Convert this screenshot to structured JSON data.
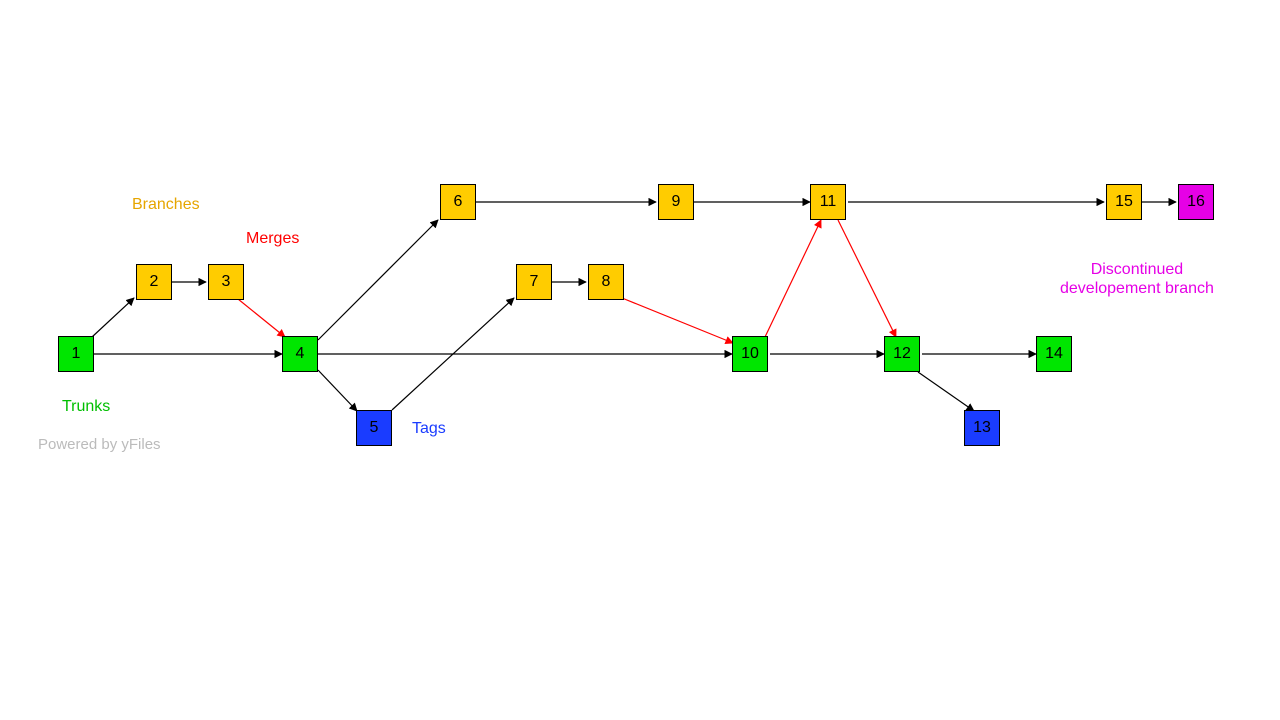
{
  "nodes": {
    "n1": "1",
    "n2": "2",
    "n3": "3",
    "n4": "4",
    "n5": "5",
    "n6": "6",
    "n7": "7",
    "n8": "8",
    "n9": "9",
    "n10": "10",
    "n11": "11",
    "n12": "12",
    "n13": "13",
    "n14": "14",
    "n15": "15",
    "n16": "16"
  },
  "labels": {
    "trunks": "Trunks",
    "branches": "Branches",
    "merges": "Merges",
    "tags": "Tags",
    "discontinued_line1": "Discontinued",
    "discontinued_line2": "developement branch",
    "powered": "Powered by yFiles"
  },
  "legend": {
    "node_types": {
      "trunk": {
        "color": "#00e600",
        "ids": [
          1,
          4,
          10,
          12,
          14
        ]
      },
      "branch": {
        "color": "#ffcc00",
        "ids": [
          2,
          3,
          6,
          7,
          8,
          9,
          11,
          15
        ]
      },
      "tag": {
        "color": "#1a3cff",
        "ids": [
          5,
          13
        ]
      },
      "discontinued": {
        "color": "#e600e6",
        "ids": [
          16
        ]
      }
    },
    "edge_types": {
      "normal": "#000000",
      "merge": "#ff0000"
    }
  },
  "edges": [
    {
      "from": 1,
      "to": 2,
      "type": "normal"
    },
    {
      "from": 2,
      "to": 3,
      "type": "normal"
    },
    {
      "from": 1,
      "to": 4,
      "type": "normal"
    },
    {
      "from": 3,
      "to": 4,
      "type": "merge"
    },
    {
      "from": 4,
      "to": 5,
      "type": "normal"
    },
    {
      "from": 4,
      "to": 6,
      "type": "normal"
    },
    {
      "from": 6,
      "to": 9,
      "type": "normal"
    },
    {
      "from": 5,
      "to": 7,
      "type": "normal"
    },
    {
      "from": 7,
      "to": 8,
      "type": "normal"
    },
    {
      "from": 4,
      "to": 10,
      "type": "normal"
    },
    {
      "from": 8,
      "to": 10,
      "type": "merge"
    },
    {
      "from": 9,
      "to": 11,
      "type": "normal"
    },
    {
      "from": 10,
      "to": 11,
      "type": "merge"
    },
    {
      "from": 10,
      "to": 12,
      "type": "normal"
    },
    {
      "from": 11,
      "to": 12,
      "type": "merge"
    },
    {
      "from": 12,
      "to": 13,
      "type": "normal"
    },
    {
      "from": 12,
      "to": 14,
      "type": "normal"
    },
    {
      "from": 11,
      "to": 15,
      "type": "normal"
    },
    {
      "from": 15,
      "to": 16,
      "type": "normal"
    }
  ]
}
